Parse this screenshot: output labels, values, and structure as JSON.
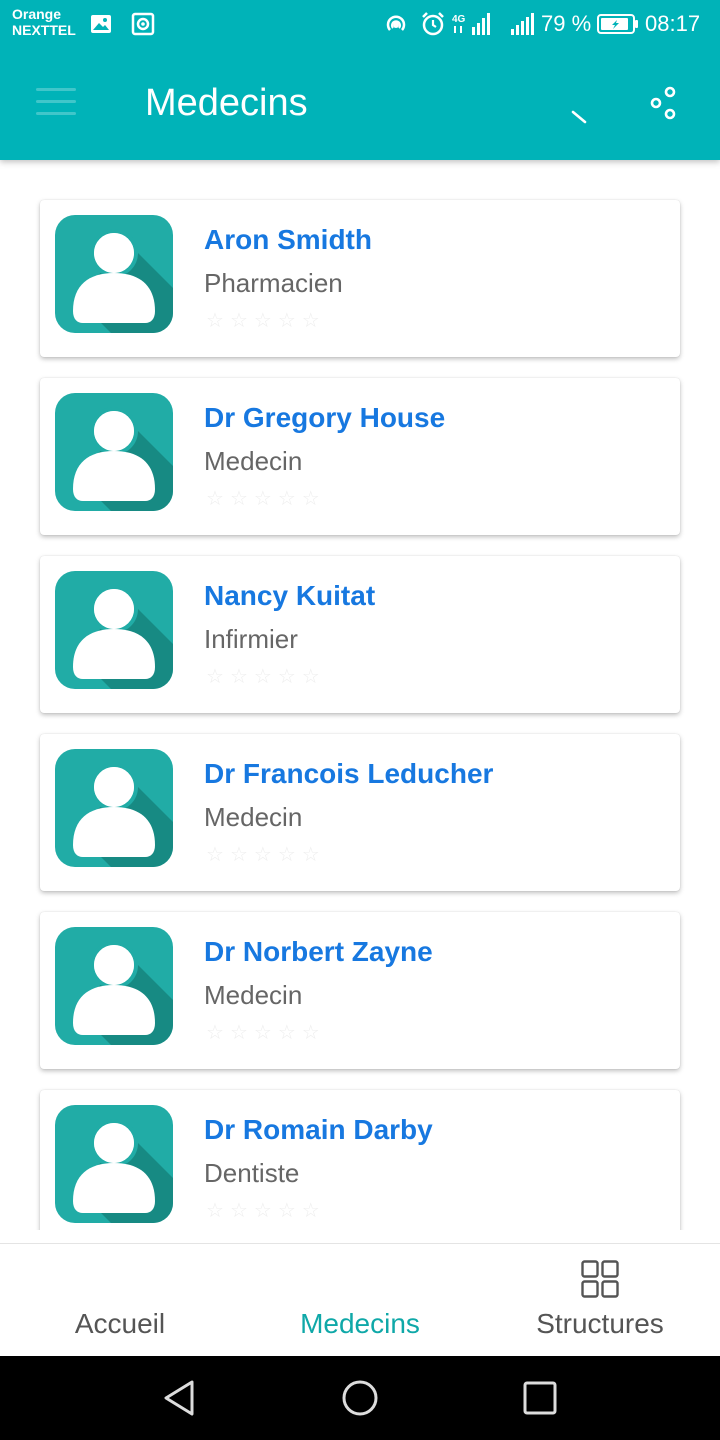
{
  "status_bar": {
    "carrier_line1": "Orange",
    "carrier_line2": "NEXTTEL",
    "battery": "79 %",
    "time": "08:17",
    "network": "4G"
  },
  "app_bar": {
    "title": "Medecins"
  },
  "doctors": [
    {
      "name": "Aron Smidth",
      "role": "Pharmacien",
      "rating": 0
    },
    {
      "name": "Dr Gregory House",
      "role": "Medecin",
      "rating": 0
    },
    {
      "name": "Nancy Kuitat",
      "role": "Infirmier",
      "rating": 0
    },
    {
      "name": "Dr Francois Leducher",
      "role": "Medecin",
      "rating": 0
    },
    {
      "name": "Dr Norbert Zayne",
      "role": "Medecin",
      "rating": 0
    },
    {
      "name": "Dr Romain Darby",
      "role": "Dentiste",
      "rating": 0
    }
  ],
  "bottom_nav": {
    "items": [
      {
        "label": "Accueil",
        "active": false
      },
      {
        "label": "Medecins",
        "active": true
      },
      {
        "label": "Structures",
        "active": false
      }
    ]
  },
  "colors": {
    "primary": "#00b3b8",
    "name_text": "#1778e0",
    "active_nav": "#0fa8a8",
    "avatar_bg": "#21aca6",
    "avatar_shadow": "#178a83"
  },
  "icons": [
    "menu-icon",
    "search-icon",
    "share-icon",
    "person-icon",
    "star-icon",
    "grid-icon",
    "back-icon",
    "home-icon",
    "recents-icon"
  ]
}
